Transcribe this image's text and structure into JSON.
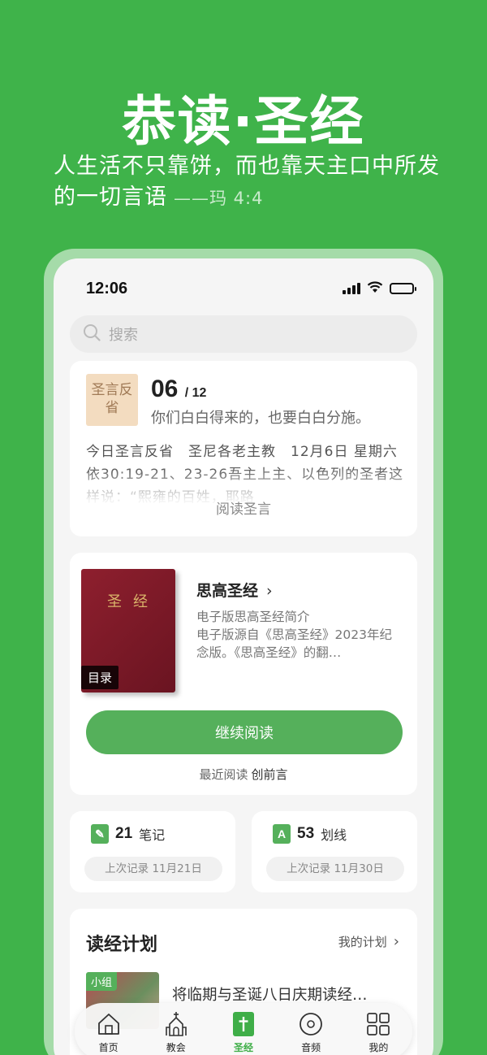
{
  "hero": {
    "title": "恭读·圣经",
    "quote": "人生活不只靠饼，而也靠天主口中所发的一切言语",
    "reference": "——玛 4:4"
  },
  "status_bar": {
    "time": "12:06",
    "battery_level": 0.8
  },
  "search": {
    "placeholder": "搜索"
  },
  "proverb": {
    "tile": "圣言反省",
    "day": "06",
    "month": "/ 12",
    "verse": "你们白白得来的，也要白白分施。",
    "body": "今日圣言反省　圣尼各老主教　12月6日 星期六　依30:19-21、23-26吾主上主、以色列的圣者这样说：“熙雍的百姓，耶路",
    "link": "阅读圣言"
  },
  "bible": {
    "cover_title": "圣经",
    "toc_label": "目录",
    "name": "思高圣经",
    "desc_line1": "电子版思高圣经简介",
    "desc_rest": "电子版源自《思高圣经》2023年纪念版。《思高圣经》的翻…",
    "continue_label": "继续阅读",
    "recent_label": "最近阅读",
    "recent_chapter": "创前言"
  },
  "stats": {
    "notes": {
      "icon": "note-icon",
      "count": "21",
      "label": "笔记",
      "last": "上次记录 11月21日"
    },
    "highlights": {
      "icon": "highlight-icon",
      "count": "53",
      "label": "划线",
      "last": "上次记录 11月30日"
    }
  },
  "plan": {
    "title": "读经计划",
    "mine_label": "我的计划",
    "item_tag": "小组",
    "item_title": "将临期与圣诞八日庆期读经…"
  },
  "tabs": [
    {
      "label": "首页",
      "icon": "home-icon"
    },
    {
      "label": "教会",
      "icon": "church-icon"
    },
    {
      "label": "圣经",
      "icon": "bible-icon",
      "active": true
    },
    {
      "label": "音频",
      "icon": "disc-icon"
    },
    {
      "label": "我的",
      "icon": "profile-grid-icon"
    }
  ],
  "colors": {
    "brand_green": "#3fb34a",
    "button_green": "#55b05b",
    "book_red": "#8e1f2e"
  }
}
